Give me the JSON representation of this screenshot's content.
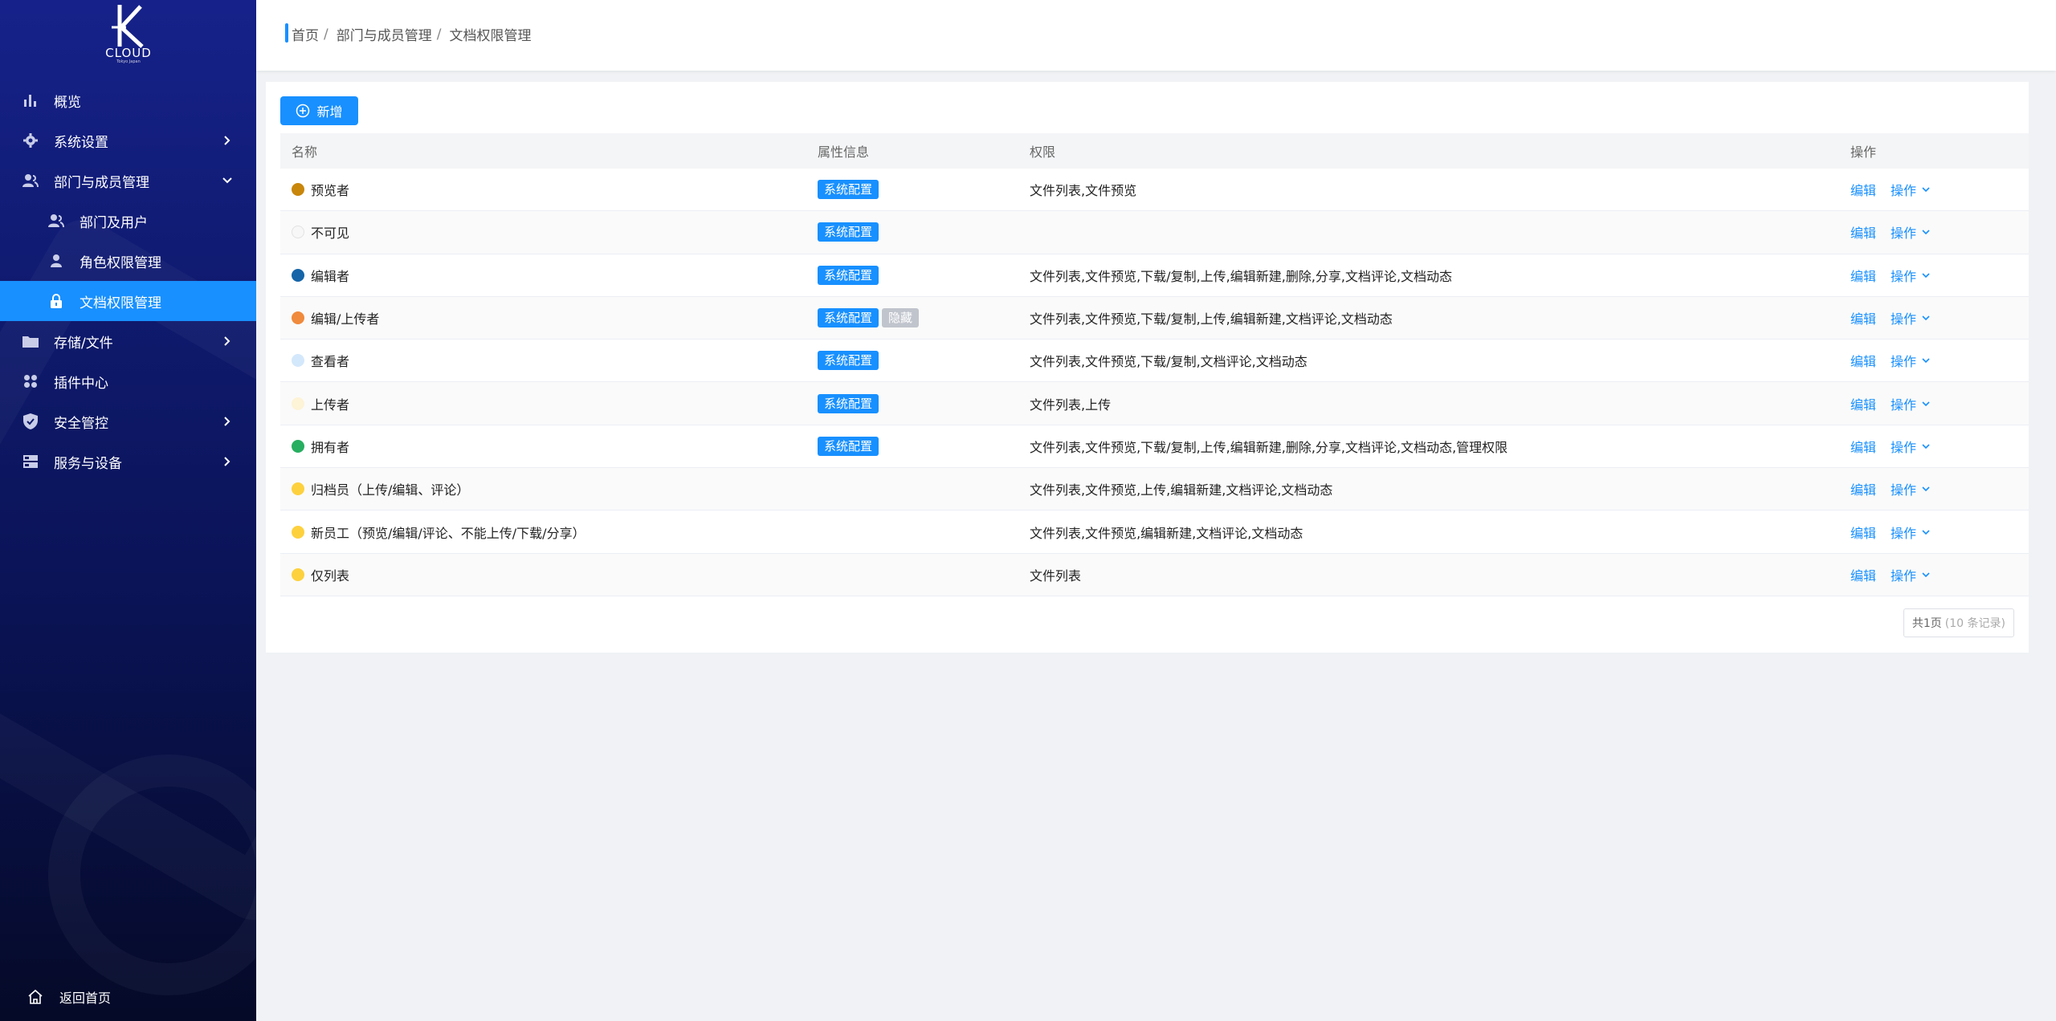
{
  "logo": {
    "text": "CLOUD",
    "sub": "Tokyo Japan"
  },
  "sidebar": {
    "items": [
      {
        "label": "概览",
        "icon": "bar-chart-icon"
      },
      {
        "label": "系统设置",
        "icon": "gear-icon"
      },
      {
        "label": "部门与成员管理",
        "icon": "users-icon"
      },
      {
        "label": "部门及用户",
        "icon": "users-icon"
      },
      {
        "label": "角色权限管理",
        "icon": "user-icon"
      },
      {
        "label": "文档权限管理",
        "icon": "lock-icon"
      },
      {
        "label": "存储/文件",
        "icon": "folder-icon"
      },
      {
        "label": "插件中心",
        "icon": "grid-icon"
      },
      {
        "label": "安全管控",
        "icon": "shield-icon"
      },
      {
        "label": "服务与设备",
        "icon": "server-icon"
      }
    ],
    "back_home": "返回首页"
  },
  "breadcrumb": {
    "home": "首页",
    "parent": "部门与成员管理",
    "current": "文档权限管理",
    "sep": "/"
  },
  "toolbar": {
    "add_label": "新增"
  },
  "table": {
    "headers": {
      "name": "名称",
      "attr": "属性信息",
      "perm": "权限",
      "op": "操作"
    },
    "rows": [
      {
        "name": "预览者",
        "color": "#c8860a",
        "tag": "系统配置",
        "tag2": "",
        "perm": "文件列表,文件预览"
      },
      {
        "name": "不可见",
        "color": "#f7f7f7",
        "tag": "系统配置",
        "tag2": "",
        "perm": ""
      },
      {
        "name": "编辑者",
        "color": "#1565a8",
        "tag": "系统配置",
        "tag2": "",
        "perm": "文件列表,文件预览,下载/复制,上传,编辑新建,删除,分享,文档评论,文档动态"
      },
      {
        "name": "编辑/上传者",
        "color": "#f08a3c",
        "tag": "系统配置",
        "tag2": "隐藏",
        "perm": "文件列表,文件预览,下载/复制,上传,编辑新建,文档评论,文档动态"
      },
      {
        "name": "查看者",
        "color": "#d4e8fb",
        "tag": "系统配置",
        "tag2": "",
        "perm": "文件列表,文件预览,下载/复制,文档评论,文档动态"
      },
      {
        "name": "上传者",
        "color": "#fdf3d6",
        "tag": "系统配置",
        "tag2": "",
        "perm": "文件列表,上传"
      },
      {
        "name": "拥有者",
        "color": "#27ae60",
        "tag": "系统配置",
        "tag2": "",
        "perm": "文件列表,文件预览,下载/复制,上传,编辑新建,删除,分享,文档评论,文档动态,管理权限"
      },
      {
        "name": "归档员（上传/编辑、评论）",
        "color": "#fdd13e",
        "tag": "",
        "tag2": "",
        "perm": "文件列表,文件预览,上传,编辑新建,文档评论,文档动态"
      },
      {
        "name": "新员工（预览/编辑/评论、不能上传/下载/分享）",
        "color": "#fdd13e",
        "tag": "",
        "tag2": "",
        "perm": "文件列表,文件预览,编辑新建,文档评论,文档动态"
      },
      {
        "name": "仅列表",
        "color": "#fdd13e",
        "tag": "",
        "tag2": "",
        "perm": "文件列表"
      }
    ],
    "edit_label": "编辑",
    "more_label": "操作"
  },
  "pager": {
    "pages": "共1页",
    "records": "(10 条记录)"
  },
  "colors": {
    "accent": "#1890ff",
    "sidebar_top": "#16228a",
    "sidebar_bottom": "#050a28"
  }
}
